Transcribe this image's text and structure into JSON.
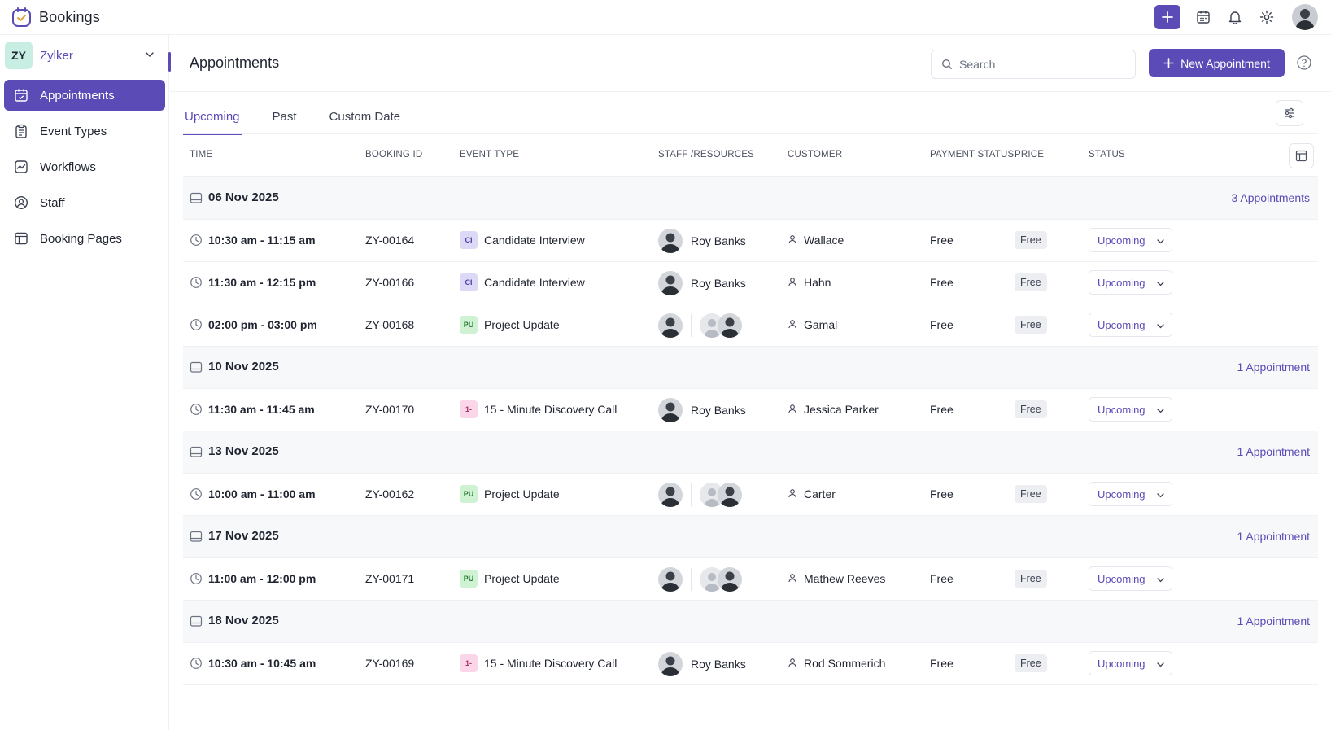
{
  "app": {
    "title": "Bookings"
  },
  "colors": {
    "accent": "#5b4bb7",
    "ci_badge": "#dcd9f7",
    "pu_badge": "#cff2d2",
    "dc_badge": "#fbd6e8"
  },
  "org": {
    "initials": "ZY",
    "name": "Zylker"
  },
  "sidebar": {
    "items": [
      {
        "label": "Appointments",
        "icon": "calendar-check-icon",
        "active": true
      },
      {
        "label": "Event Types",
        "icon": "clipboard-icon",
        "active": false
      },
      {
        "label": "Workflows",
        "icon": "workflow-icon",
        "active": false
      },
      {
        "label": "Staff",
        "icon": "user-circle-icon",
        "active": false
      },
      {
        "label": "Booking Pages",
        "icon": "booking-page-icon",
        "active": false
      }
    ]
  },
  "header": {
    "title": "Appointments",
    "search_placeholder": "Search",
    "new_button": "New Appointment"
  },
  "tabs": [
    "Upcoming",
    "Past",
    "Custom Date"
  ],
  "columns": {
    "time": "TIME",
    "booking_id": "BOOKING ID",
    "event_type": "EVENT TYPE",
    "staff": "STAFF /RESOURCES",
    "customer": "CUSTOMER",
    "payment_status": "PAYMENT STATUS",
    "price": "PRICE",
    "status": "STATUS"
  },
  "groups": [
    {
      "date": "06 Nov 2025",
      "count": "3 Appointments",
      "rows": [
        {
          "time": "10:30 am - 11:15 am",
          "id": "ZY-00164",
          "badge": "CI",
          "event": "Candidate Interview",
          "staff": "Roy Banks",
          "multi": false,
          "customer": "Wallace",
          "payment": "Free",
          "price": "Free",
          "status": "Upcoming"
        },
        {
          "time": "11:30 am - 12:15 pm",
          "id": "ZY-00166",
          "badge": "CI",
          "event": "Candidate Interview",
          "staff": "Roy Banks",
          "multi": false,
          "customer": "Hahn",
          "payment": "Free",
          "price": "Free",
          "status": "Upcoming"
        },
        {
          "time": "02:00 pm - 03:00 pm",
          "id": "ZY-00168",
          "badge": "PU",
          "event": "Project Update",
          "staff": "",
          "multi": true,
          "customer": "Gamal",
          "payment": "Free",
          "price": "Free",
          "status": "Upcoming"
        }
      ]
    },
    {
      "date": "10 Nov 2025",
      "count": "1 Appointment",
      "rows": [
        {
          "time": "11:30 am - 11:45 am",
          "id": "ZY-00170",
          "badge": "1-",
          "event": "15 - Minute Discovery Call",
          "staff": "Roy Banks",
          "multi": false,
          "customer": "Jessica Parker",
          "payment": "Free",
          "price": "Free",
          "status": "Upcoming"
        }
      ]
    },
    {
      "date": "13 Nov 2025",
      "count": "1 Appointment",
      "rows": [
        {
          "time": "10:00 am - 11:00 am",
          "id": "ZY-00162",
          "badge": "PU",
          "event": "Project Update",
          "staff": "",
          "multi": true,
          "customer": "Carter",
          "payment": "Free",
          "price": "Free",
          "status": "Upcoming"
        }
      ]
    },
    {
      "date": "17 Nov 2025",
      "count": "1 Appointment",
      "rows": [
        {
          "time": "11:00 am - 12:00 pm",
          "id": "ZY-00171",
          "badge": "PU",
          "event": "Project Update",
          "staff": "",
          "multi": true,
          "customer": "Mathew Reeves",
          "payment": "Free",
          "price": "Free",
          "status": "Upcoming"
        }
      ]
    },
    {
      "date": "18 Nov 2025",
      "count": "1 Appointment",
      "rows": [
        {
          "time": "10:30 am - 10:45 am",
          "id": "ZY-00169",
          "badge": "1-",
          "event": "15 - Minute Discovery Call",
          "staff": "Roy Banks",
          "multi": false,
          "customer": "Rod Sommerich",
          "payment": "Free",
          "price": "Free",
          "status": "Upcoming"
        }
      ]
    }
  ]
}
